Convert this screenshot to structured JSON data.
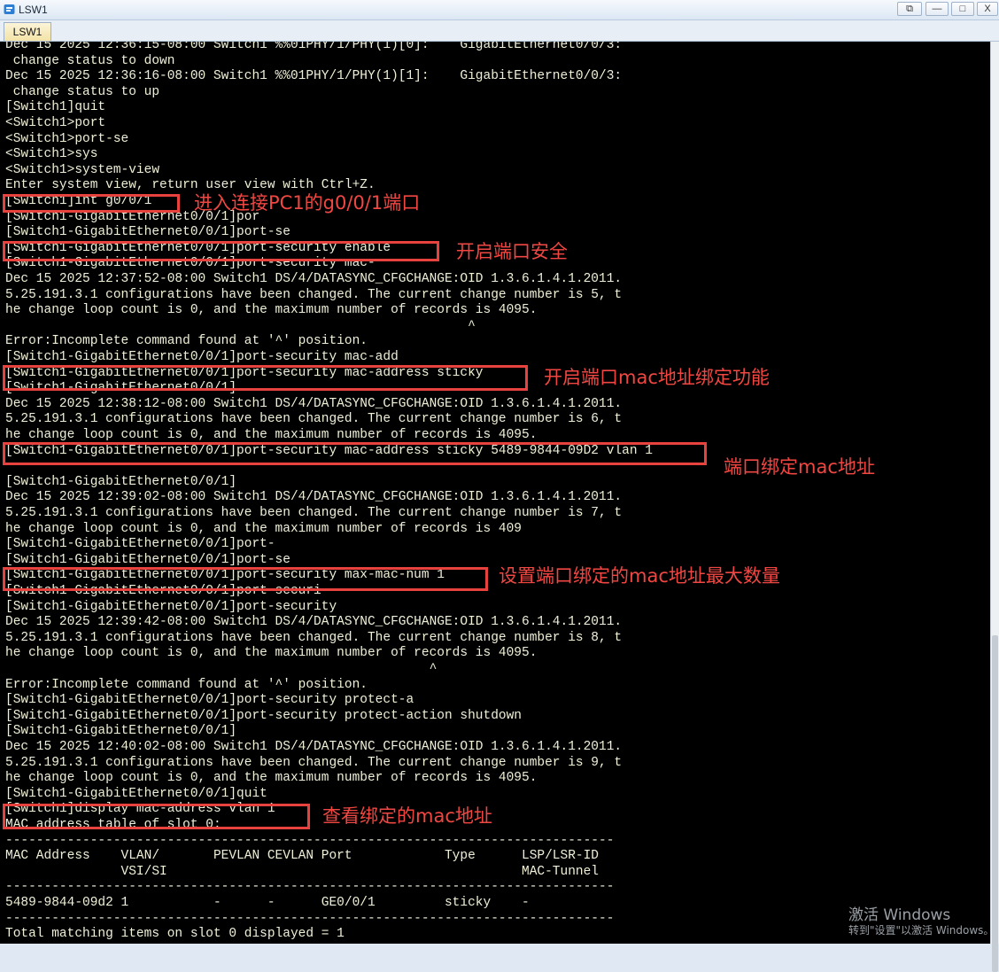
{
  "window": {
    "title": "LSW1",
    "tab": "LSW1",
    "buttons": {
      "restore": "⧉",
      "minimize": "—",
      "maximize": "□",
      "close": "X"
    }
  },
  "terminal": {
    "lines": [
      "Dec 15 2025 12:36:15-08:00 Switch1 %%01PHY/1/PHY(1)[0]:    GigabitEthernet0/0/3:",
      " change status to down",
      "Dec 15 2025 12:36:16-08:00 Switch1 %%01PHY/1/PHY(1)[1]:    GigabitEthernet0/0/3:",
      " change status to up",
      "[Switch1]quit",
      "<Switch1>port",
      "<Switch1>port-se",
      "<Switch1>sys",
      "<Switch1>system-view",
      "Enter system view, return user view with Ctrl+Z.",
      "[Switch1]int g0/0/1",
      "[Switch1-GigabitEthernet0/0/1]por",
      "[Switch1-GigabitEthernet0/0/1]port-se",
      "[Switch1-GigabitEthernet0/0/1]port-security enable",
      "[Switch1-GigabitEthernet0/0/1]port-security mac-",
      "Dec 15 2025 12:37:52-08:00 Switch1 DS/4/DATASYNC_CFGCHANGE:OID 1.3.6.1.4.1.2011.",
      "5.25.191.3.1 configurations have been changed. The current change number is 5, t",
      "he change loop count is 0, and the maximum number of records is 4095.",
      "                                                            ^",
      "Error:Incomplete command found at '^' position.",
      "[Switch1-GigabitEthernet0/0/1]port-security mac-add",
      "[Switch1-GigabitEthernet0/0/1]port-security mac-address sticky",
      "[Switch1-GigabitEthernet0/0/1]",
      "Dec 15 2025 12:38:12-08:00 Switch1 DS/4/DATASYNC_CFGCHANGE:OID 1.3.6.1.4.1.2011.",
      "5.25.191.3.1 configurations have been changed. The current change number is 6, t",
      "he change loop count is 0, and the maximum number of records is 4095.",
      "[Switch1-GigabitEthernet0/0/1]port-security mac-address sticky 5489-9844-09D2 vlan 1",
      "",
      "[Switch1-GigabitEthernet0/0/1]",
      "Dec 15 2025 12:39:02-08:00 Switch1 DS/4/DATASYNC_CFGCHANGE:OID 1.3.6.1.4.1.2011.",
      "5.25.191.3.1 configurations have been changed. The current change number is 7, t",
      "he change loop count is 0, and the maximum number of records is 409",
      "[Switch1-GigabitEthernet0/0/1]port-",
      "[Switch1-GigabitEthernet0/0/1]port-se",
      "[Switch1-GigabitEthernet0/0/1]port-security max-mac-num 1",
      "[Switch1-GigabitEthernet0/0/1]port-securi",
      "[Switch1-GigabitEthernet0/0/1]port-security",
      "Dec 15 2025 12:39:42-08:00 Switch1 DS/4/DATASYNC_CFGCHANGE:OID 1.3.6.1.4.1.2011.",
      "5.25.191.3.1 configurations have been changed. The current change number is 8, t",
      "he change loop count is 0, and the maximum number of records is 4095.",
      "                                                       ^",
      "Error:Incomplete command found at '^' position.",
      "[Switch1-GigabitEthernet0/0/1]port-security protect-a",
      "[Switch1-GigabitEthernet0/0/1]port-security protect-action shutdown",
      "[Switch1-GigabitEthernet0/0/1]",
      "Dec 15 2025 12:40:02-08:00 Switch1 DS/4/DATASYNC_CFGCHANGE:OID 1.3.6.1.4.1.2011.",
      "5.25.191.3.1 configurations have been changed. The current change number is 9, t",
      "he change loop count is 0, and the maximum number of records is 4095.",
      "[Switch1-GigabitEthernet0/0/1]quit",
      "[Switch1]display mac-address vlan 1",
      "MAC address table of slot 0:",
      "-------------------------------------------------------------------------------",
      "MAC Address    VLAN/       PEVLAN CEVLAN Port            Type      LSP/LSR-ID",
      "               VSI/SI                                              MAC-Tunnel",
      "-------------------------------------------------------------------------------",
      "5489-9844-09d2 1           -      -      GE0/0/1         sticky    -",
      "-------------------------------------------------------------------------------",
      "Total matching items on slot 0 displayed = 1"
    ]
  },
  "annotations": [
    "进入连接PC1的g0/0/1端口",
    "开启端口安全",
    "开启端口mac地址绑定功能",
    "端口绑定mac地址",
    "设置端口绑定的mac地址最大数量",
    "查看绑定的mac地址"
  ],
  "watermark": {
    "title": "激活 Windows",
    "subtitle": "转到\"设置\"以激活 Windows。"
  },
  "colors": {
    "terminal_bg": "#000000",
    "terminal_text": "#f0f0d8",
    "annotation_red": "#e8423f"
  }
}
